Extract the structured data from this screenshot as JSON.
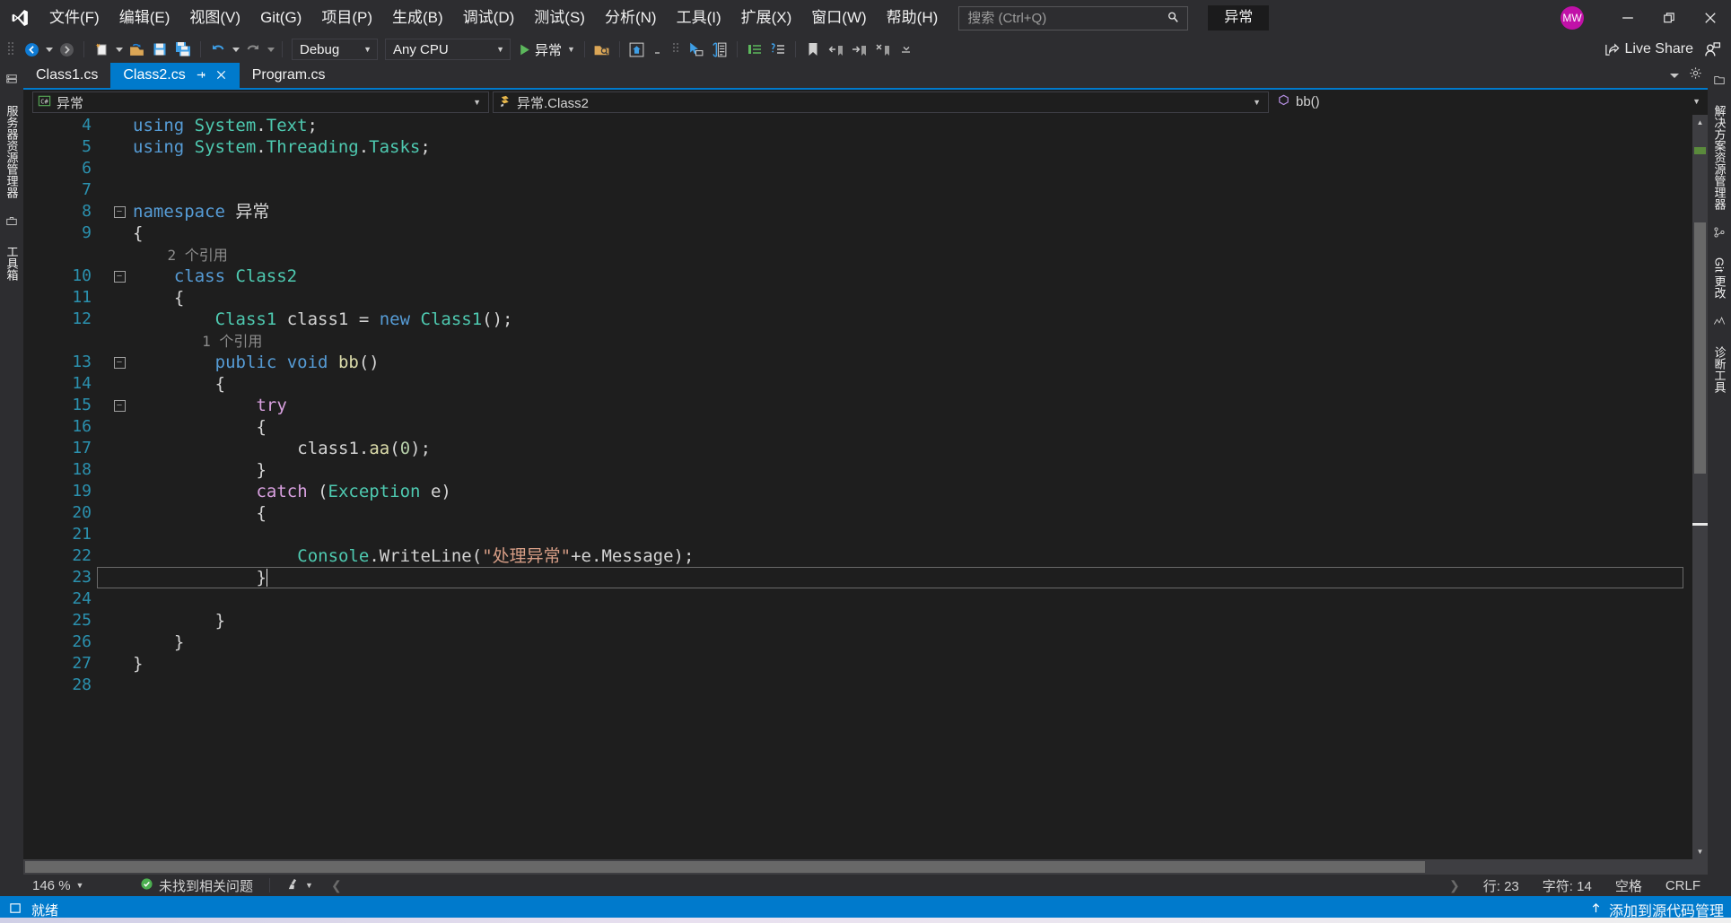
{
  "menu": {
    "items": [
      {
        "label": "文件(F)",
        "accel": "F"
      },
      {
        "label": "编辑(E)",
        "accel": "E"
      },
      {
        "label": "视图(V)",
        "accel": "V"
      },
      {
        "label": "Git(G)",
        "accel": "G"
      },
      {
        "label": "项目(P)",
        "accel": "P"
      },
      {
        "label": "生成(B)",
        "accel": "B"
      },
      {
        "label": "调试(D)",
        "accel": "D"
      },
      {
        "label": "测试(S)",
        "accel": "S"
      },
      {
        "label": "分析(N)",
        "accel": "N"
      },
      {
        "label": "工具(I)",
        "accel": "I"
      },
      {
        "label": "扩展(X)",
        "accel": "X"
      },
      {
        "label": "窗口(W)",
        "accel": "W"
      },
      {
        "label": "帮助(H)",
        "accel": "H"
      }
    ],
    "search_placeholder": "搜索 (Ctrl+Q)",
    "search_value": "",
    "project_badge": "异常",
    "avatar_initials": "MW"
  },
  "toolbar": {
    "config": "Debug",
    "platform": "Any CPU",
    "run_label": "异常",
    "live_share": "Live Share"
  },
  "rails": {
    "left": [
      "服务器资源管理器",
      "工具箱"
    ],
    "right": [
      "解决方案资源管理器",
      "Git 更改",
      "诊断工具"
    ]
  },
  "tabs": [
    {
      "label": "Class1.cs",
      "active": false,
      "pinned": false,
      "closable": false
    },
    {
      "label": "Class2.cs",
      "active": true,
      "pinned": true,
      "closable": true
    },
    {
      "label": "Program.cs",
      "active": false,
      "pinned": false,
      "closable": false
    }
  ],
  "navbar": {
    "project": "异常",
    "type": "异常.Class2",
    "member": "bb()"
  },
  "code": {
    "first_line": 4,
    "lines": [
      {
        "n": 4,
        "changed": false,
        "fold": "",
        "text": "using System.Text;"
      },
      {
        "n": 5,
        "changed": true,
        "fold": "",
        "text": "using System.Threading.Tasks;"
      },
      {
        "n": 6,
        "changed": true,
        "fold": "",
        "text": ""
      },
      {
        "n": 7,
        "changed": false,
        "fold": "",
        "text": ""
      },
      {
        "n": 8,
        "changed": false,
        "fold": "-",
        "text": "namespace 异常"
      },
      {
        "n": 9,
        "changed": false,
        "fold": "",
        "text": "{"
      },
      {
        "n": "",
        "changed": false,
        "fold": "",
        "text": "    2 个引用",
        "codelens": true
      },
      {
        "n": 10,
        "changed": false,
        "fold": "-",
        "text": "    class Class2"
      },
      {
        "n": 11,
        "changed": true,
        "fold": "",
        "text": "    {"
      },
      {
        "n": 12,
        "changed": true,
        "fold": "",
        "text": "        Class1 class1 = new Class1();"
      },
      {
        "n": "",
        "changed": true,
        "fold": "",
        "text": "        1 个引用",
        "codelens": true
      },
      {
        "n": 13,
        "changed": true,
        "fold": "-",
        "text": "        public void bb()"
      },
      {
        "n": 14,
        "changed": true,
        "fold": "",
        "text": "        {"
      },
      {
        "n": 15,
        "changed": true,
        "fold": "-",
        "text": "            try"
      },
      {
        "n": 16,
        "changed": true,
        "fold": "",
        "text": "            {"
      },
      {
        "n": 17,
        "changed": true,
        "fold": "",
        "text": "                class1.aa(0);"
      },
      {
        "n": 18,
        "changed": true,
        "fold": "",
        "text": "            }"
      },
      {
        "n": 19,
        "changed": true,
        "fold": "",
        "text": "            catch (Exception e)"
      },
      {
        "n": 20,
        "changed": true,
        "fold": "",
        "text": "            {"
      },
      {
        "n": 21,
        "changed": true,
        "fold": "",
        "text": ""
      },
      {
        "n": 22,
        "changed": true,
        "fold": "",
        "text": "                Console.WriteLine(\"处理异常\"+e.Message);"
      },
      {
        "n": 23,
        "changed": true,
        "fold": "",
        "text": "            }",
        "current": true
      },
      {
        "n": 24,
        "changed": true,
        "fold": "",
        "text": ""
      },
      {
        "n": 25,
        "changed": true,
        "fold": "",
        "text": "        }"
      },
      {
        "n": 26,
        "changed": false,
        "fold": "",
        "text": "    }"
      },
      {
        "n": 27,
        "changed": false,
        "fold": "",
        "text": "}"
      },
      {
        "n": 28,
        "changed": false,
        "fold": "",
        "text": ""
      }
    ]
  },
  "editor_status": {
    "zoom": "146 %",
    "issues": "未找到相关问题",
    "line": "行: 23",
    "column": "字符: 14",
    "indent": "空格",
    "eol": "CRLF"
  },
  "statusbar": {
    "state": "就绪",
    "notice": "添加到源代码管理"
  },
  "colors": {
    "accent": "#007acc",
    "titlebar_bg": "#2d2d30",
    "editor_bg": "#1e1e1e",
    "avatar": "#c111a8",
    "changed_bar": "#6a9b46",
    "keyword": "#569cd6",
    "type": "#4ec9b0",
    "string": "#d69d85",
    "control_keyword": "#d8a0df",
    "number": "#b5cea8",
    "codelens": "#8d8d8d"
  }
}
